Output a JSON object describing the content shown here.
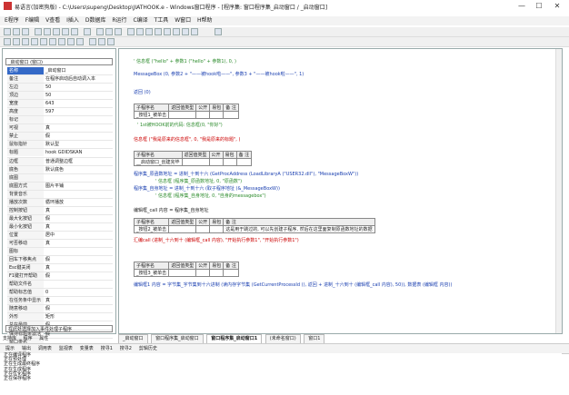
{
  "window": {
    "title": "易语言(加密狗版) - C:\\Users\\supeng\\Desktop\\JIATHOOK.e - Windows窗口程序 - [程序集: 窗口程序集_启动窗口 / _启动窗口]",
    "min": "—",
    "max": "☐",
    "close": "✕"
  },
  "menu": [
    "E程序",
    "F编辑",
    "V查看",
    "I插入",
    "D数据库",
    "R运行",
    "C编译",
    "T工具",
    "W窗口",
    "H帮助"
  ],
  "left": {
    "selector": "_启动窗口 (窗口)",
    "props": [
      [
        "名称",
        "_启动窗口"
      ],
      [
        "备注",
        "在程序启动后自动调入本"
      ],
      [
        "左边",
        "50"
      ],
      [
        "顶边",
        "50"
      ],
      [
        "宽度",
        "643"
      ],
      [
        "高度",
        "597"
      ],
      [
        "标记",
        ""
      ],
      [
        "可视",
        "真"
      ],
      [
        "禁止",
        "假"
      ],
      [
        "鼠标指针",
        "默认型"
      ],
      [
        "标题",
        "hook GDIDSKAN"
      ],
      [
        "边框",
        "普通调整边框"
      ],
      [
        "底色",
        "默认底色"
      ],
      [
        "底图",
        ""
      ],
      [
        "底图方式",
        "图片平铺"
      ],
      [
        "背景音乐",
        ""
      ],
      [
        "播放次数",
        "循环播放"
      ],
      [
        "控制按钮",
        "真"
      ],
      [
        "最大化按钮",
        "假"
      ],
      [
        "最小化按钮",
        "真"
      ],
      [
        "位置",
        "居中"
      ],
      [
        "可否移动",
        "真"
      ],
      [
        "图标",
        ""
      ],
      [
        "回车下移焦点",
        "假"
      ],
      [
        "Esc键关闭",
        "真"
      ],
      [
        "F1键打开帮助",
        "假"
      ],
      [
        "帮助文件名",
        ""
      ],
      [
        "帮助标志值",
        "0"
      ],
      [
        "在任务条中显示",
        "真"
      ],
      [
        "随意移动",
        "假"
      ],
      [
        "外形",
        "矩形"
      ],
      [
        "总在最前",
        "假"
      ],
      [
        "保持标题条激活",
        "假"
      ],
      [
        "窗口类名",
        ""
      ]
    ],
    "event_box": "在此处选择加入事件处理子程序",
    "tabs": [
      "支持库",
      "程序",
      "属性"
    ]
  },
  "code": {
    "l1": "' 信息框 (\"hello\" + 参数1 (\"hello\" + 参数1), 0, )",
    "l2": "MessageBox (0, 参数2 + \"——被hook啦——\", 参数3 + \"——被hook啦——\", 1)",
    "l3": "返回 (0)",
    "t1h": [
      "子程序名",
      "返回值类型",
      "公开",
      "易包",
      "备 注"
    ],
    "t1r": [
      "_按钮1_被单击",
      "",
      "",
      "",
      ""
    ],
    "l4": "' 1st被HOOK前的代码: 信息框(0, \"你好\")",
    "l5": "信息框 (\"我是原来的信息框\", 0, \"我是原来的标题\", )",
    "t2h": [
      "子程序名",
      "返回值类型",
      "公开",
      "易包",
      "备 注"
    ],
    "t2r": [
      "__启动窗口_创建完毕",
      "",
      "",
      "",
      ""
    ],
    "l6": "程序集_原函数地址 = 进制_十到十六 (GetProcAddress (LoadLibraryA (\"USER32.dll\"), \"MessageBoxW\"))",
    "l7": "' 信息框 (程序集_原函数地址, 0, \"原函数\")",
    "l8": "程序集_自身地址 = 进制_十到十六 (取子程序地址 (&_MessageBoxW))",
    "l9": "' 信息框 (程序集_自身地址, 0, \"自身的messagebox\")",
    "l10": "编辑框_call 内容 = 程序集_自身地址",
    "t3h": [
      "子程序名",
      "返回值类型",
      "公开",
      "易包",
      "备 注"
    ],
    "t3r": [
      "_按钮2_被单击",
      "",
      "",
      "",
      "这是用于跳过的, 可以先创建子程序, 然后在这里面复制原函数地址的数据"
    ],
    "l11": "汇编call (进制_十六到十 (编辑框_call 内容), \"开始执行参数1\", \"开始执行参数1\")",
    "t4h": [
      "子程序名",
      "返回值类型",
      "公开",
      "易包",
      "备 注"
    ],
    "t4r": [
      "_按钮3_被单击",
      "",
      "",
      "",
      ""
    ],
    "l12": "编辑框1 内容 = 字节集_字节集到十六进制 (读内存字节集 (GetCurrentProcessId (), 返回 + 进制_十六到十 (编辑框_call 内容), 50)), 数据表 (编辑框 内容))"
  },
  "bottom_tabs": [
    "_启动窗口",
    "窗口程序集_启动窗口",
    "窗口程序集_启动窗口1",
    "(未命名窗口)",
    "窗口1"
  ],
  "output_tabs": [
    "提示",
    "输出",
    "调用表",
    "监视表",
    "变量表",
    "搜寻1",
    "搜寻2",
    "剪辑历史"
  ],
  "output_lines": [
    "正在编译程序",
    "正在预处理",
    "正在生成最终程序",
    "正在生成程序",
    "正在优化程序",
    "正在保存程序"
  ]
}
